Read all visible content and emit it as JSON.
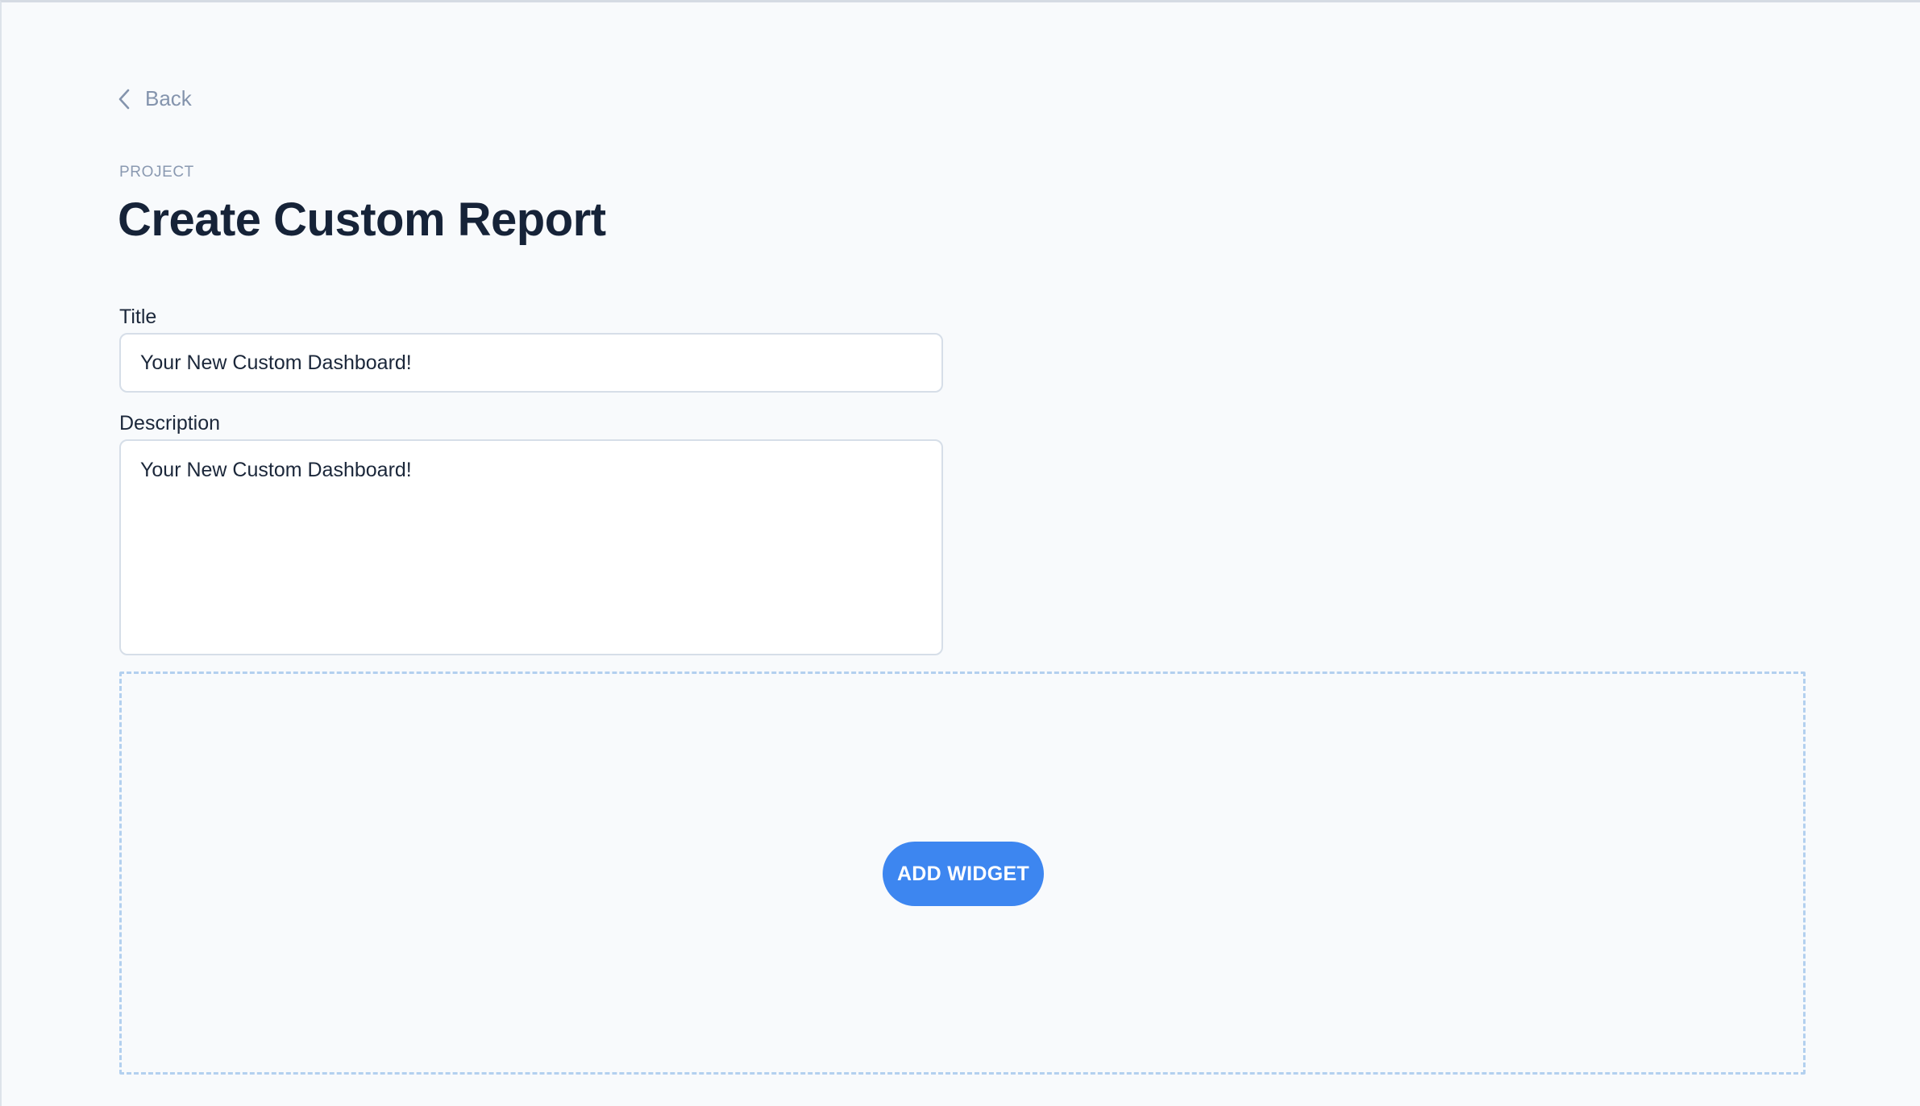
{
  "nav": {
    "back_label": "Back"
  },
  "header": {
    "eyebrow": "PROJECT",
    "title": "Create Custom Report"
  },
  "form": {
    "title_label": "Title",
    "title_value": "Your New Custom Dashboard!",
    "description_label": "Description",
    "description_value": "Your New Custom Dashboard!"
  },
  "widget_zone": {
    "add_button_label": "ADD WIDGET"
  },
  "icons": {
    "back": "chevron-left-icon"
  },
  "colors": {
    "accent": "#3d86f0",
    "title_text": "#162338",
    "muted_text": "#8494ad",
    "dashed_border": "#b3d0ef",
    "background": "#f8fafc"
  }
}
